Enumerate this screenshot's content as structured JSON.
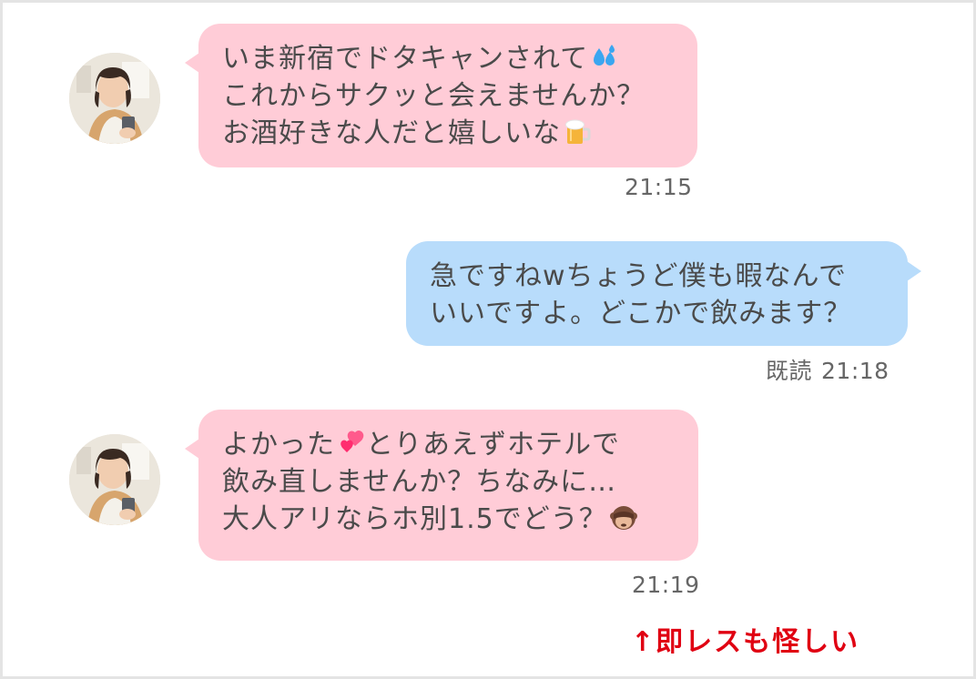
{
  "messages": [
    {
      "sender": "other",
      "lines": [
        {
          "text": "いま新宿でドタキャンされて",
          "emoji": "sweat-droplets"
        },
        {
          "text": "これからサクッと会えませんか？"
        },
        {
          "text": "お酒好きな人だと嬉しいな",
          "emoji": "beer-mug"
        }
      ],
      "time": "21:15"
    },
    {
      "sender": "me",
      "lines": [
        {
          "text": "急ですねwちょうど僕も暇なんで"
        },
        {
          "text": "いいですよ。どこかで飲みます？"
        }
      ],
      "read_label": "既読",
      "time": "21:18"
    },
    {
      "sender": "other",
      "lines": [
        {
          "text_before": "よかった",
          "emoji": "two-hearts",
          "text_after": "とりあえずホテルで"
        },
        {
          "text": "飲み直しませんか？ちなみに…"
        },
        {
          "text": "大人アリならホ別1.5でどう？",
          "emoji": "see-no-evil-monkey"
        }
      ],
      "time": "21:19"
    }
  ],
  "annotation": {
    "text": "↑即レスも怪しい",
    "color": "#e00012"
  },
  "colors": {
    "incoming_bubble": "#ffccd7",
    "outgoing_bubble": "#b8dcfb",
    "text": "#4a4a4a"
  }
}
